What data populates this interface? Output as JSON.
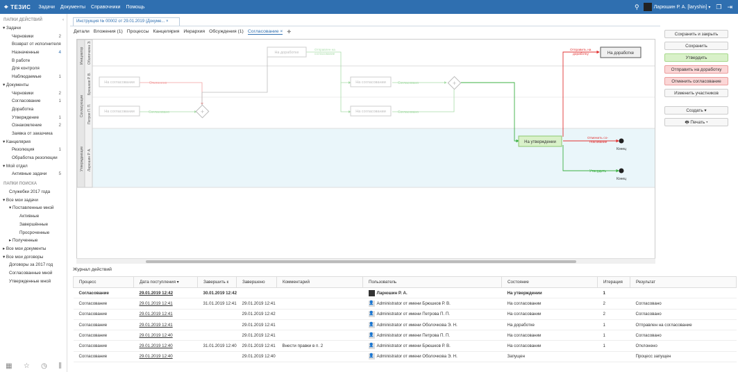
{
  "app": {
    "logo": "ТЕЗИС",
    "menu": [
      "Задачи",
      "Документы",
      "Справочники",
      "Помощь"
    ],
    "user": "Ларюшин Р. А. [laryshin]"
  },
  "sidebar": {
    "folders_title": "ПАПКИ ДЕЙСТВИЙ",
    "collapse": "‹",
    "items": [
      {
        "label": "▾ Задачи",
        "count": "",
        "indent": 0
      },
      {
        "label": "Черновики",
        "count": "2",
        "indent": 1
      },
      {
        "label": "Возврат от исполнителя",
        "count": "",
        "indent": 1
      },
      {
        "label": "Назначенные",
        "count": "4",
        "indent": 1,
        "blue": true
      },
      {
        "label": "В работе",
        "count": "",
        "indent": 1
      },
      {
        "label": "Для контроля",
        "count": "",
        "indent": 1
      },
      {
        "label": "Наблюдаемые",
        "count": "1",
        "indent": 1
      },
      {
        "label": "▾ Документы",
        "count": "",
        "indent": 0
      },
      {
        "label": "Черновики",
        "count": "2",
        "indent": 1
      },
      {
        "label": "Согласование",
        "count": "1",
        "indent": 1
      },
      {
        "label": "Доработка",
        "count": "",
        "indent": 1
      },
      {
        "label": "Утверждение",
        "count": "1",
        "indent": 1
      },
      {
        "label": "Ознакомление",
        "count": "2",
        "indent": 1
      },
      {
        "label": "Заявка от заказчика",
        "count": "",
        "indent": 1
      },
      {
        "label": "▾ Канцелярия",
        "count": "",
        "indent": 0
      },
      {
        "label": "Резолюция",
        "count": "1",
        "indent": 1
      },
      {
        "label": "Обработка резолюции",
        "count": "",
        "indent": 1
      },
      {
        "label": "▾ Мой отдел",
        "count": "",
        "indent": 0
      },
      {
        "label": "Активные задачи",
        "count": "5",
        "indent": 1
      }
    ],
    "search_title": "ПАПКИ ПОИСКА",
    "search_items": [
      {
        "label": "Служебки 2017 года",
        "indent": 1
      },
      {
        "label": "▾ Все мои задачи",
        "indent": 0
      },
      {
        "label": "▾ Поставленные мной",
        "indent": 1
      },
      {
        "label": "Активные",
        "indent": 2
      },
      {
        "label": "Завершённые",
        "indent": 2
      },
      {
        "label": "Просроченные",
        "indent": 2
      },
      {
        "label": "▸ Полученные",
        "indent": 1
      },
      {
        "label": "▸ Все мои документы",
        "indent": 0
      },
      {
        "label": "▾ Все мои договоры",
        "indent": 0
      },
      {
        "label": "Договоры за 2017 год",
        "indent": 1
      },
      {
        "label": "Согласованные мной",
        "indent": 1
      },
      {
        "label": "Утвержденные мной",
        "indent": 1
      }
    ]
  },
  "doc_tab": "Инструкция № 00002 от 29.01.2019 (Докуме...  ×",
  "tabs": [
    "Детали",
    "Вложения (1)",
    "Процессы",
    "Канцелярия",
    "Иерархия",
    "Обсуждения (1)",
    "Согласование ×",
    "✚"
  ],
  "diagram": {
    "lanes": [
      "Инициатор",
      "Оболочкина Э.",
      "Согласующие",
      "Брюшков Р. В.",
      "Петров П. П.",
      "Утверждающие",
      "Ларюшин Р. А."
    ],
    "boxes": {
      "approval1": "На согласовании",
      "approval2": "На согласовании",
      "approval3": "На согласовании",
      "approval4": "На согласовании",
      "rework1": "На доработке",
      "rework2": "На доработке",
      "approve": "На утверждении"
    },
    "labels": {
      "rejected": "Отклонено",
      "agreed1": "Согласовано",
      "agreed2": "Согласовано",
      "agreed3": "Согласовано",
      "sent_approval": "Отправлен на согласование",
      "send_rework": "Отправить на доработку",
      "cancel": "Отменить согласование",
      "approved": "Утвердить",
      "end1": "Конец",
      "end2": "Конец"
    }
  },
  "actions": [
    "Сохранить и закрыть",
    "Сохранить",
    "Утвердить",
    "Отправить на доработку",
    "Отменить согласование",
    "Изменить участников",
    "Создать ▾",
    "🖶 Печать ▾"
  ],
  "journal": {
    "title": "Журнал действий",
    "columns": [
      "Процесс",
      "Дата поступления ▾",
      "Завершить к",
      "Завершено",
      "Комментарий",
      "Пользователь",
      "Состояние",
      "Итерация",
      "Результат"
    ],
    "rows": [
      [
        "Согласование",
        "29.01.2019 12:42",
        "30.01.2019 12:42",
        "",
        "",
        "Ларюшин Р. А.",
        "На утверждении",
        "1",
        ""
      ],
      [
        "Согласование",
        "29.01.2019 12:41",
        "31.01.2019 12:41",
        "29.01.2019 12:41",
        "",
        "Administrator от имени Брюшков Р. В.",
        "На согласовании",
        "2",
        "Согласовано"
      ],
      [
        "Согласование",
        "29.01.2019 12:41",
        "",
        "29.01.2019 12:42",
        "",
        "Administrator от имени Петрова П. П.",
        "На согласовании",
        "2",
        "Согласовано"
      ],
      [
        "Согласование",
        "29.01.2019 12:41",
        "",
        "29.01.2019 12:41",
        "",
        "Administrator от имени Оболочкова Э. Н.",
        "На доработке",
        "1",
        "Отправлен на согласование"
      ],
      [
        "Согласование",
        "29.01.2019 12:40",
        "",
        "29.01.2019 12:41",
        "",
        "Administrator от имени Петрова П. П.",
        "На согласовании",
        "1",
        "Согласовано"
      ],
      [
        "Согласование",
        "29.01.2019 12:40",
        "31.01.2019 12:40",
        "29.01.2019 12:41",
        "Внести правки в п. 2",
        "Administrator от имени Брюшков Р. В.",
        "На согласовании",
        "1",
        "Отклонено"
      ],
      [
        "Согласование",
        "29.01.2019 12:40",
        "",
        "29.01.2019 12:40",
        "",
        "Administrator от имени Оболочкова Э. Н.",
        "Запущен",
        "",
        "Процесс запущен"
      ]
    ]
  },
  "colors": {
    "accent": "#2f6fb0",
    "green": "#3cb043",
    "red": "#e03030",
    "lane_blue": "#eaf6fa"
  }
}
